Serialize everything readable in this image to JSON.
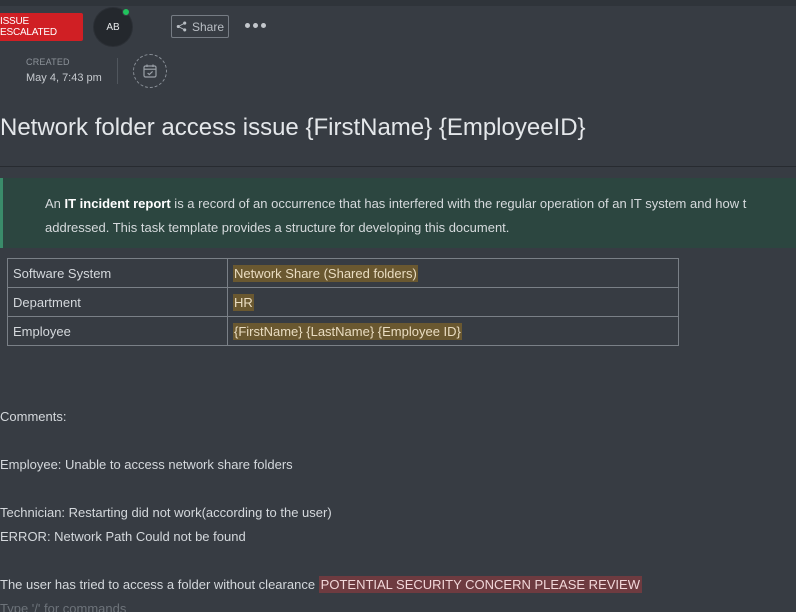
{
  "header": {
    "badge_label": "ISSUE ESCALATED",
    "avatar_initials": "AB",
    "share_label": "Share",
    "created_label": "CREATED",
    "created_date": "May 4, 7:43 pm"
  },
  "title": "Network folder access issue {FirstName} {EmployeeID}",
  "callout": {
    "prefix": "An ",
    "bold": "IT incident report",
    "rest": " is a record of an occurrence that has interfered with the regular operation of an IT system and how t",
    "line2": "addressed. This task template provides a structure for developing this document."
  },
  "info_table": {
    "rows": [
      {
        "key": "Software System",
        "value": "Network Share  (Shared folders)"
      },
      {
        "key": "Department",
        "value": "HR"
      },
      {
        "key": "Employee",
        "value": "{FirstName} {LastName} {Employee ID}"
      }
    ]
  },
  "comments": {
    "heading": "Comments:",
    "employee_line": "Employee: Unable to access network share folders",
    "technician_line": "Technician: Restarting did not work(according to the user)",
    "error_line": "ERROR: Network Path Could not be found",
    "clearance_text": "The user has tried to access a folder without clearance ",
    "security_flag": "POTENTIAL SECURITY CONCERN PLEASE REVIEW"
  },
  "editor": {
    "placeholder": "Type '/' for commands"
  },
  "colors": {
    "background": "#373c43",
    "badge": "#d01f24",
    "online": "#21c35d",
    "callout_bg": "#2c4640",
    "highlight_amber": "#6a5830",
    "highlight_red": "#6e3b40"
  }
}
